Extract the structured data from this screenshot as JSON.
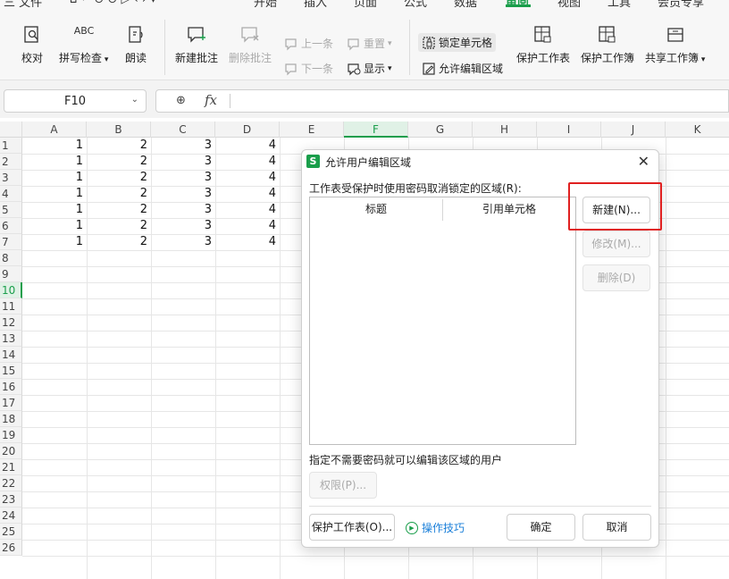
{
  "menu": {
    "file": "三 文件",
    "tabs": [
      "开始",
      "插入",
      "页面",
      "公式",
      "数据",
      "审阅",
      "视图",
      "工具",
      "会员专享"
    ],
    "active_tab": "审阅"
  },
  "ribbon": {
    "proofread": "校对",
    "spellcheck": "拼写检查",
    "spellcheck_icon_text": "ABC",
    "read_aloud": "朗读",
    "new_comment": "新建批注",
    "delete_comment": "删除批注",
    "prev": "上一条",
    "next": "下一条",
    "reset": "重置",
    "show": "显示",
    "lock_cell": "锁定单元格",
    "allow_edit_range": "允许编辑区域",
    "protect_sheet": "保护工作表",
    "protect_workbook": "保护工作簿",
    "share_workbook": "共享工作簿"
  },
  "formula_bar": {
    "name_box": "F10",
    "fx": "fx",
    "value": ""
  },
  "grid": {
    "columns": [
      "A",
      "B",
      "C",
      "D",
      "E",
      "F",
      "G",
      "H",
      "I",
      "J",
      "K"
    ],
    "selected_column": "F",
    "rows": [
      "1",
      "2",
      "3",
      "4",
      "5",
      "6",
      "7",
      "8",
      "9",
      "10",
      "11",
      "12",
      "13",
      "14",
      "15",
      "16",
      "17",
      "18",
      "19",
      "20",
      "21",
      "22",
      "23",
      "24",
      "25",
      "26"
    ],
    "selected_row": "10",
    "data": [
      [
        "1",
        "2",
        "3",
        "4"
      ],
      [
        "1",
        "2",
        "3",
        "4"
      ],
      [
        "1",
        "2",
        "3",
        "4"
      ],
      [
        "1",
        "2",
        "3",
        "4"
      ],
      [
        "1",
        "2",
        "3",
        "4"
      ],
      [
        "1",
        "2",
        "3",
        "4"
      ],
      [
        "1",
        "2",
        "3",
        "4"
      ]
    ]
  },
  "dialog": {
    "title": "允许用户编辑区域",
    "logo": "S",
    "close": "✕",
    "list_label": "工作表受保护时使用密码取消锁定的区域(R):",
    "col_title": "标题",
    "col_ref": "引用单元格",
    "btn_new": "新建(N)...",
    "btn_modify": "修改(M)...",
    "btn_delete": "删除(D)",
    "users_label": "指定不需要密码就可以编辑该区域的用户",
    "btn_perm": "权限(P)...",
    "btn_protect": "保护工作表(O)...",
    "tips": "操作技巧",
    "btn_ok": "确定",
    "btn_cancel": "取消"
  },
  "colors": {
    "accent": "#1a9e4b",
    "highlight_box": "#e02020",
    "link": "#1a7fd9"
  }
}
